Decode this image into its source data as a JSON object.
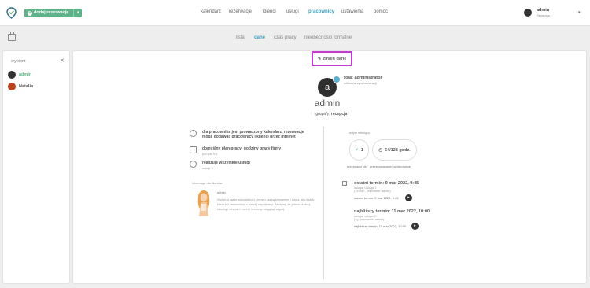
{
  "header": {
    "add_button_label": "dodaj rezerwację",
    "nav": [
      {
        "label": "kalendarz",
        "active": false
      },
      {
        "label": "rezerwacje",
        "active": false
      },
      {
        "label": "klienci",
        "active": false
      },
      {
        "label": "usługi",
        "active": false
      },
      {
        "label": "pracownicy",
        "active": true
      },
      {
        "label": "ustawienia",
        "active": false
      },
      {
        "label": "pomoc",
        "active": false
      }
    ],
    "user": {
      "name": "admin",
      "role": "Recepcja"
    }
  },
  "subtabs": [
    {
      "label": "lista",
      "active": false
    },
    {
      "label": "dane",
      "active": true
    },
    {
      "label": "czas pracy",
      "active": false
    },
    {
      "label": "nieobecności formalne",
      "active": false
    }
  ],
  "sidebar": {
    "title": "wybierz",
    "employees": [
      {
        "name": "admin",
        "color": "#333333"
      },
      {
        "name": "Natalia",
        "color": "#b8431e"
      }
    ]
  },
  "profile": {
    "change_label": "zmień dane",
    "avatar_letter": "a",
    "role_label": "rola: administrator",
    "sync_label": "odbiorca synchronizacji",
    "name": "admin",
    "groups_prefix": "grupa/y:",
    "groups_value": "recepcja"
  },
  "info": {
    "calendar_note": "dla pracownika jest prowadzony kalendarz, rezerwacje mogą dodawać pracownicy i klienci przez internet",
    "schedule_title": "domyślny plan pracy: godziny pracy firmy",
    "schedule_sub": "pon-pią 9-5",
    "services_title": "realizuje wszystkie usługi",
    "services_sub": "usługi: 0",
    "client_info_label": "informacje dla klientów",
    "message_author": "admin",
    "message_text": "Wybieraj swoje stanowisko z pełnym zaangażowaniem i pasją, aby każdy klient był zadowolony z naszej współpracy. Pamiętaj, że jesteś częścią naszego zespołu i razem możemy osiągnąć więcej."
  },
  "stats": {
    "title": "w tym miesiącu",
    "reservations_value": "1",
    "reservations_label": "rezerwacje ok",
    "hours_value": "64/128 godz.",
    "hours_label": "przepracowane/zaplanowane"
  },
  "terms": {
    "last_title": "ostatni termin: 9 mar 2022, 9:45",
    "last_service": "usługa: Usługa 1",
    "last_meta": "(15 min., pracownik: admin)",
    "last_link": "ostatni termin: 9 mar 2022, 9:45",
    "next_title": "najbliższy termin: 11 mar 2022, 10:00",
    "next_service": "usługa: usługa 2",
    "next_meta": "(1g. pracownik: admin)",
    "next_link": "najbliższy termin: 11 mar 2022, 10:00"
  },
  "colors": {
    "accent": "#3fa0bf",
    "green": "#5fb38a",
    "highlight": "#c43bd1"
  }
}
